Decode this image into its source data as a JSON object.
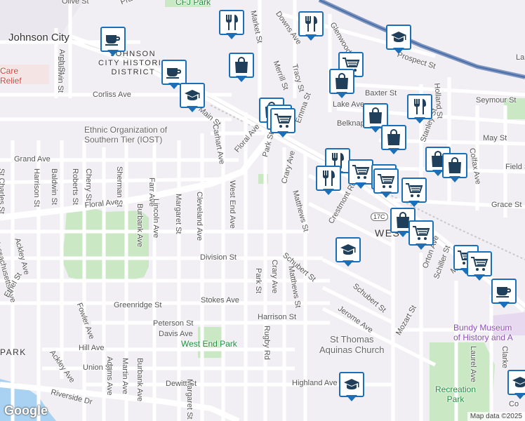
{
  "map": {
    "city": "Johnson City",
    "district": [
      "JOHNSON",
      "CITY HISTORIC",
      "DISTRICT"
    ],
    "area_west": "WEST",
    "area_park": "PARK",
    "parks": [
      "CFJ Park",
      "West End Park",
      "Recreation",
      "Park"
    ],
    "poi": {
      "iost": [
        "Ethnic Organization of",
        "Southern Tier (IOST)"
      ],
      "bundy": [
        "Bundy Museum",
        "of History and A"
      ],
      "church": [
        "St Thomas",
        "Aquinas Church"
      ],
      "care": [
        "Care",
        "Relief"
      ]
    },
    "route_shield": "17C",
    "streets": [
      "Olive St",
      "Pratt Ave",
      "Market St",
      "Downs Ave",
      "Glenwood",
      "Prospect St",
      "La",
      "Baldwin St",
      "Arch St",
      "Merrill St",
      "Tracy St",
      "Corliss Ave",
      "Lake Ave",
      "Baxter St",
      "Seymour St",
      "Holland St",
      "Main St",
      "Belknap Ave",
      "Carhart Ave",
      "Emma St",
      "May St",
      "Stanley St",
      "Colfax Ave",
      "Grand Ave",
      "Floral Ave",
      "Park St",
      "Field St",
      "St Charles St",
      "Harrison St",
      "Baldwin St",
      "Roberts St",
      "Cherry St",
      "Sherman St",
      "Farr Ave",
      "Crary Ave",
      "Matthews St",
      "Grace St",
      "Floral Ave",
      "Burbank Ave",
      "Lincoln Ave",
      "Margaret St",
      "Cleveland Ave",
      "West End Ave",
      "Crestmont Rd",
      "Massachusetts Ave",
      "Ackley Ave",
      "Division St",
      "Schubert St",
      "Orton Ave",
      "Schiller St",
      "Main St",
      "Park St",
      "Crary Ave",
      "Matthews St",
      "Schubert St",
      "Ethel St",
      "Greenridge St",
      "Stokes Ave",
      "Jerome Ave",
      "Fowler Ave",
      "Peterson St",
      "Harrison St",
      "Davis Ave",
      "Hill Ave",
      "Ackley Ave",
      "Union St",
      "Adams Ave",
      "Martin Ave",
      "Burbank Ave",
      "Rugby Rd",
      "Mozart St",
      "Laurel Ave",
      "Clarke",
      "Dewitt St",
      "Margaret St",
      "Riverside Dr",
      "Highland Ave",
      "Co"
    ],
    "google": "Google",
    "copyright": "Map data ©2025"
  },
  "colors": {
    "pin_border": "#1b6fb8",
    "pin_icon": "#1f3f5a",
    "park_green": "#c9e8c3",
    "park_label": "#1e8e3e",
    "poi_purple": "#8a4fb3",
    "river": "#a9d2f2",
    "railway": "#4a6ea8"
  },
  "pins": [
    {
      "name": "restaurant-pin",
      "icon": "fork-knife-icon"
    },
    {
      "name": "restaurant-pin",
      "icon": "fork-knife-icon"
    },
    {
      "name": "coffee-pin",
      "icon": "coffee-cup-icon"
    },
    {
      "name": "school-pin",
      "icon": "graduation-cap-icon"
    },
    {
      "name": "store-pin",
      "icon": "shopping-bag-icon"
    },
    {
      "name": "grocery-pin",
      "icon": "shopping-cart-icon"
    },
    {
      "name": "coffee-pin",
      "icon": "coffee-cup-icon"
    },
    {
      "name": "store-pin",
      "icon": "shopping-bag-icon"
    },
    {
      "name": "school-pin",
      "icon": "graduation-cap-icon"
    },
    {
      "name": "store-pin",
      "icon": "shopping-bag-icon"
    },
    {
      "name": "grocery-pin",
      "icon": "shopping-cart-icon"
    },
    {
      "name": "restaurant-pin",
      "icon": "fork-knife-icon"
    },
    {
      "name": "store-pin",
      "icon": "shopping-bag-icon"
    },
    {
      "name": "grocery-pin",
      "icon": "shopping-cart-icon"
    },
    {
      "name": "store-pin",
      "icon": "shopping-bag-icon"
    },
    {
      "name": "store-pin",
      "icon": "shopping-bag-icon"
    },
    {
      "name": "store-pin",
      "icon": "shopping-bag-icon"
    },
    {
      "name": "restaurant-pin",
      "icon": "fork-knife-icon"
    },
    {
      "name": "restaurant-pin",
      "icon": "fork-knife-icon"
    },
    {
      "name": "grocery-pin",
      "icon": "shopping-cart-icon"
    },
    {
      "name": "restaurant-pin",
      "icon": "fork-knife-icon"
    },
    {
      "name": "grocery-pin",
      "icon": "shopping-cart-icon"
    },
    {
      "name": "grocery-pin",
      "icon": "shopping-cart-icon"
    },
    {
      "name": "store-pin",
      "icon": "shopping-bag-icon"
    },
    {
      "name": "grocery-pin",
      "icon": "shopping-cart-icon"
    },
    {
      "name": "school-pin",
      "icon": "graduation-cap-icon"
    },
    {
      "name": "grocery-pin",
      "icon": "shopping-cart-icon"
    },
    {
      "name": "grocery-pin",
      "icon": "shopping-cart-icon"
    },
    {
      "name": "coffee-pin",
      "icon": "coffee-cup-icon"
    },
    {
      "name": "school-pin",
      "icon": "graduation-cap-icon"
    },
    {
      "name": "school-pin",
      "icon": "graduation-cap-icon"
    }
  ]
}
